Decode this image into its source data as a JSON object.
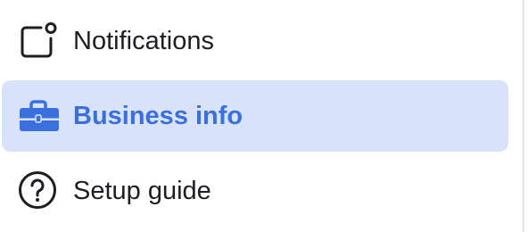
{
  "menu": {
    "items": [
      {
        "label": "Notifications",
        "icon": "notification-icon",
        "selected": false
      },
      {
        "label": "Business info",
        "icon": "briefcase-icon",
        "selected": true
      },
      {
        "label": "Setup guide",
        "icon": "question-circle-icon",
        "selected": false
      }
    ]
  },
  "colors": {
    "selected_background": "#d8e3fa",
    "selected_text": "#3a6fe0",
    "text": "#1c1e21",
    "icon": "#1c1e21"
  }
}
